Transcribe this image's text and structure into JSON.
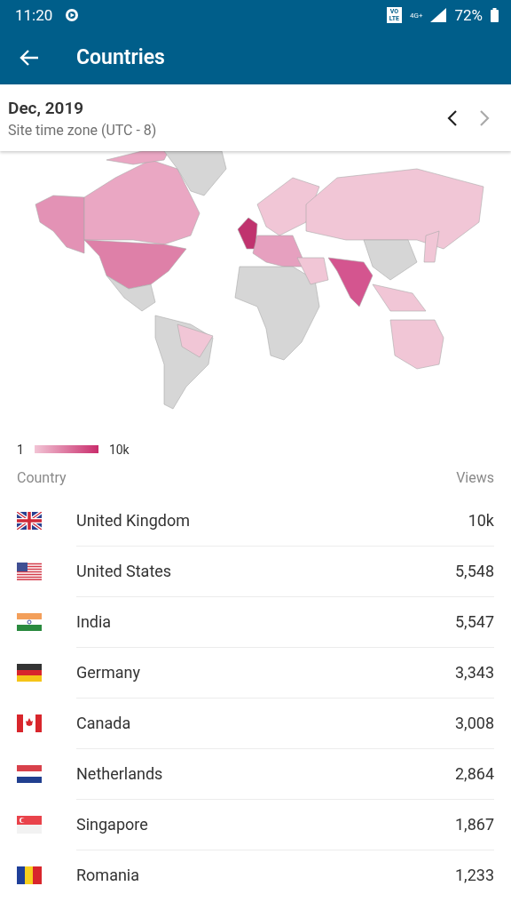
{
  "status_bar": {
    "time": "11:20",
    "volte_badge": [
      "VO",
      "LTE"
    ],
    "network_type": "4G+",
    "battery": "72%"
  },
  "app_bar": {
    "title": "Countries"
  },
  "period": {
    "title": "Dec, 2019",
    "subtitle": "Site time zone (UTC - 8)",
    "previous_disabled": false,
    "next_disabled": true
  },
  "legend": {
    "min": "1",
    "max": "10k"
  },
  "table": {
    "columns": [
      "Country",
      "Views"
    ],
    "rows": [
      {
        "kind": "gb",
        "country": "United Kingdom",
        "views": "10k"
      },
      {
        "kind": "us",
        "country": "United States",
        "views": "5,548"
      },
      {
        "kind": "in",
        "country": "India",
        "views": "5,547"
      },
      {
        "kind": "de",
        "country": "Germany",
        "views": "3,343"
      },
      {
        "kind": "ca",
        "country": "Canada",
        "views": "3,008"
      },
      {
        "kind": "nl",
        "country": "Netherlands",
        "views": "2,864"
      },
      {
        "kind": "sg",
        "country": "Singapore",
        "views": "1,867"
      },
      {
        "kind": "ro",
        "country": "Romania",
        "views": "1,233"
      }
    ]
  }
}
